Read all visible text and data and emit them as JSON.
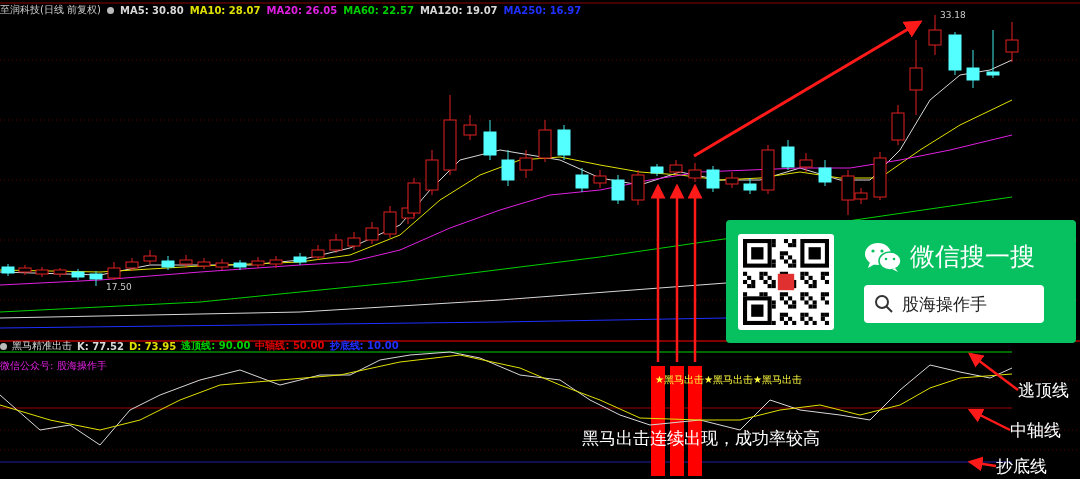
{
  "main_chart": {
    "stock_title": "至润科技(日线 前复权)",
    "ma_legend": [
      {
        "label": "MA5: 30.80",
        "color": "#d8d8d8"
      },
      {
        "label": "MA10: 28.07",
        "color": "#e0e000"
      },
      {
        "label": "MA20: 26.05",
        "color": "#e020e0"
      },
      {
        "label": "MA60: 22.57",
        "color": "#00d000"
      },
      {
        "label": "MA120: 19.07",
        "color": "#d8d8d8"
      },
      {
        "label": "MA250: 16.97",
        "color": "#2030ff"
      }
    ],
    "low_label": "17.50",
    "high_label": "33.18"
  },
  "promo_card": {
    "title": "微信搜一搜",
    "search_text": "股海操作手"
  },
  "indicator": {
    "name": "黑马精准出击",
    "values": [
      {
        "label": "K: 77.52",
        "color": "#d8d8d8"
      },
      {
        "label": "D: 73.95",
        "color": "#e0e000"
      },
      {
        "label": "逃顶线: 90.00",
        "color": "#00d000"
      },
      {
        "label": "中轴线: 50.00",
        "color": "#e00000"
      },
      {
        "label": "抄底线: 10.00",
        "color": "#2030ff"
      }
    ],
    "note": "微信公众号: 股海操作手",
    "signals": [
      "★黑马出击",
      "★黑马出击",
      "★黑马出击"
    ]
  },
  "annotations": {
    "caption": "黑马出击连续出现，成功率较高",
    "line_labels": [
      "逃顶线",
      "中轴线",
      "抄底线"
    ]
  }
}
